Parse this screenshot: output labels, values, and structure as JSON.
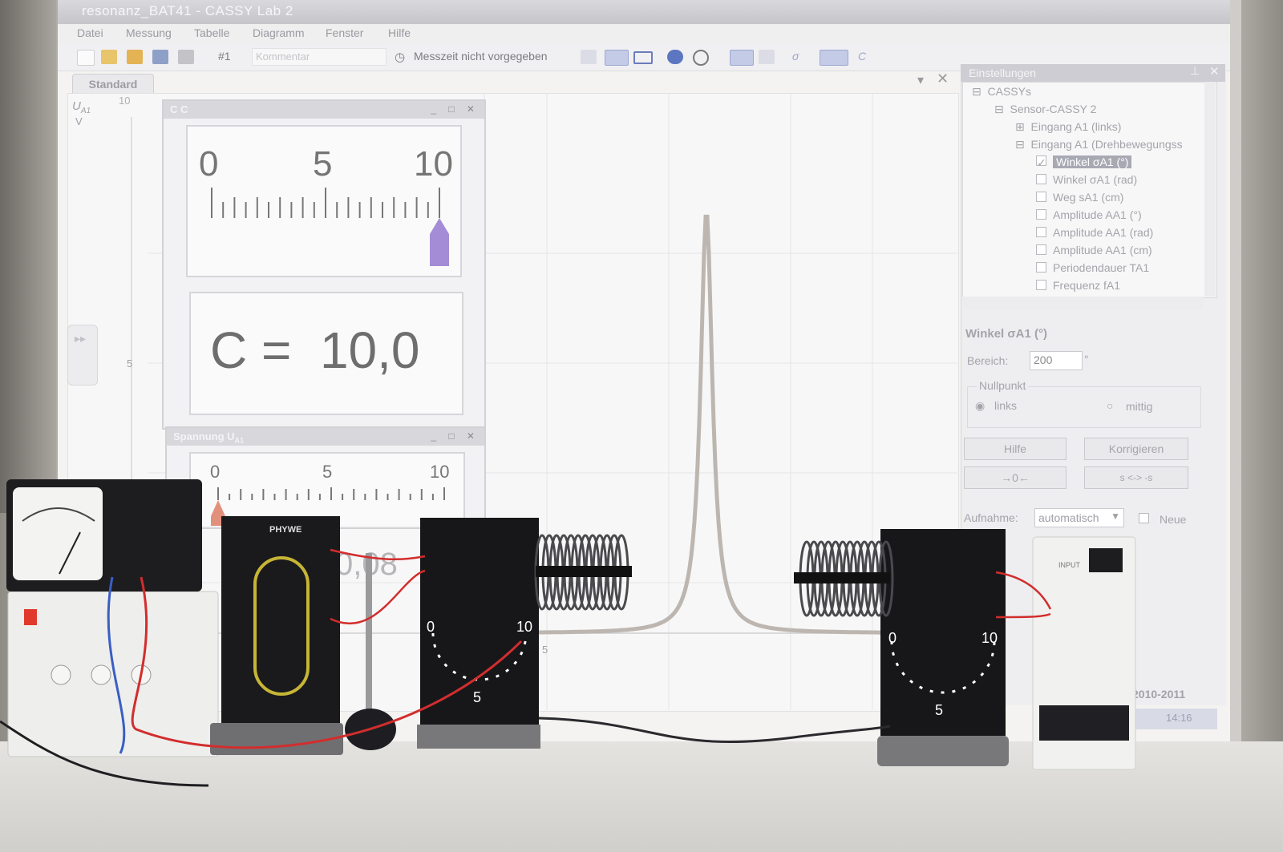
{
  "window": {
    "title": "resonanz_BAT41 - CASSY Lab 2",
    "menu": [
      "Datei",
      "Messung",
      "Tabelle",
      "Diagramm",
      "Fenster",
      "Hilfe"
    ]
  },
  "toolbar": {
    "series": "#1",
    "comment_placeholder": "Kommentar",
    "measure_time": "Messzeit nicht vorgegeben"
  },
  "tab": {
    "label": "Standard"
  },
  "diagram": {
    "y_axis_label": "U",
    "y_axis_sub": "A1",
    "y_axis_unit": "V",
    "y_ticks": [
      "10",
      "5"
    ],
    "x_tick": "5",
    "peak_x_fraction": 0.5,
    "peak_height_fraction": 0.78
  },
  "meter_c": {
    "title": "C C",
    "scale": [
      "0",
      "5",
      "10"
    ],
    "pointer_value": 10.0,
    "pointer_max": 10,
    "readout": "C =  10,0"
  },
  "meter_u": {
    "title": "Spannung U",
    "title_sub": "A1",
    "scale": [
      "0",
      "5",
      "10"
    ],
    "pointer_value": 0.0,
    "pointer_max": 10,
    "readout": "0,08"
  },
  "settings": {
    "title": "Einstellungen",
    "tree": [
      {
        "label": "CASSYs",
        "level": 0,
        "type": "folder"
      },
      {
        "label": "Sensor-CASSY 2",
        "level": 1,
        "type": "folder"
      },
      {
        "label": "Eingang A1 (links)",
        "level": 2,
        "type": "folder"
      },
      {
        "label": "Eingang A1 (Drehbewegungss",
        "level": 2,
        "type": "folder"
      },
      {
        "label": "Winkel σA1 (°)",
        "level": 3,
        "type": "check",
        "checked": true,
        "selected": true
      },
      {
        "label": "Winkel σA1 (rad)",
        "level": 3,
        "type": "check",
        "checked": false
      },
      {
        "label": "Weg sA1 (cm)",
        "level": 3,
        "type": "check",
        "checked": false
      },
      {
        "label": "Amplitude AA1 (°)",
        "level": 3,
        "type": "check",
        "checked": false
      },
      {
        "label": "Amplitude AA1 (rad)",
        "level": 3,
        "type": "check",
        "checked": false
      },
      {
        "label": "Amplitude AA1 (cm)",
        "level": 3,
        "type": "check",
        "checked": false
      },
      {
        "label": "Periodendauer TA1",
        "level": 3,
        "type": "check",
        "checked": false
      },
      {
        "label": "Frequenz fA1",
        "level": 3,
        "type": "check",
        "checked": false
      }
    ],
    "section_title": "Winkel σA1 (°)",
    "bereich_label": "Bereich:",
    "bereich_value": "200",
    "bereich_unit": "°",
    "nullpunkt_label": "Nullpunkt",
    "radio_links": "links",
    "radio_mittig": "mittig",
    "btn_hilfe": "Hilfe",
    "btn_korrigieren": "Korrigieren",
    "btn_zero": "→0←",
    "btn_swap": "s <-> -s",
    "aufnahme_label": "Aufnahme:",
    "aufnahme_value": "automatisch",
    "neue_label": "Neue"
  },
  "taskbar": {
    "copyright": "2010-2011",
    "clock": "14:16"
  },
  "devices": {
    "brand": "PHYWE",
    "dial_scale": [
      "0",
      "10",
      "5"
    ],
    "cassy_input": "INPUT"
  }
}
